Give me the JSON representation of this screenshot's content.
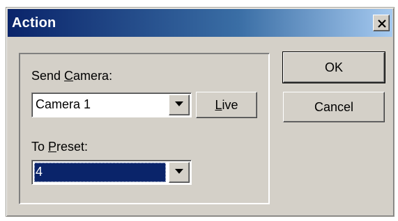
{
  "window": {
    "title": "Action",
    "close_glyph": "✕"
  },
  "send_camera": {
    "label_before": "Send ",
    "label_mnemonic": "C",
    "label_after": "amera:",
    "selected_value": "Camera 1"
  },
  "live_button": {
    "mnemonic": "L",
    "label_after": "ive"
  },
  "to_preset": {
    "label_before": "To ",
    "label_mnemonic": "P",
    "label_after": "reset:",
    "selected_value": "4"
  },
  "buttons": {
    "ok_label": "OK",
    "cancel_label": "Cancel"
  },
  "icons": {
    "close": "close-icon",
    "dropdown": "chevron-down-icon"
  },
  "colors": {
    "title_gradient_start": "#0a246a",
    "title_gradient_end": "#a6caf0",
    "dialog_face": "#d4d0c8",
    "selection": "#0a246a"
  }
}
